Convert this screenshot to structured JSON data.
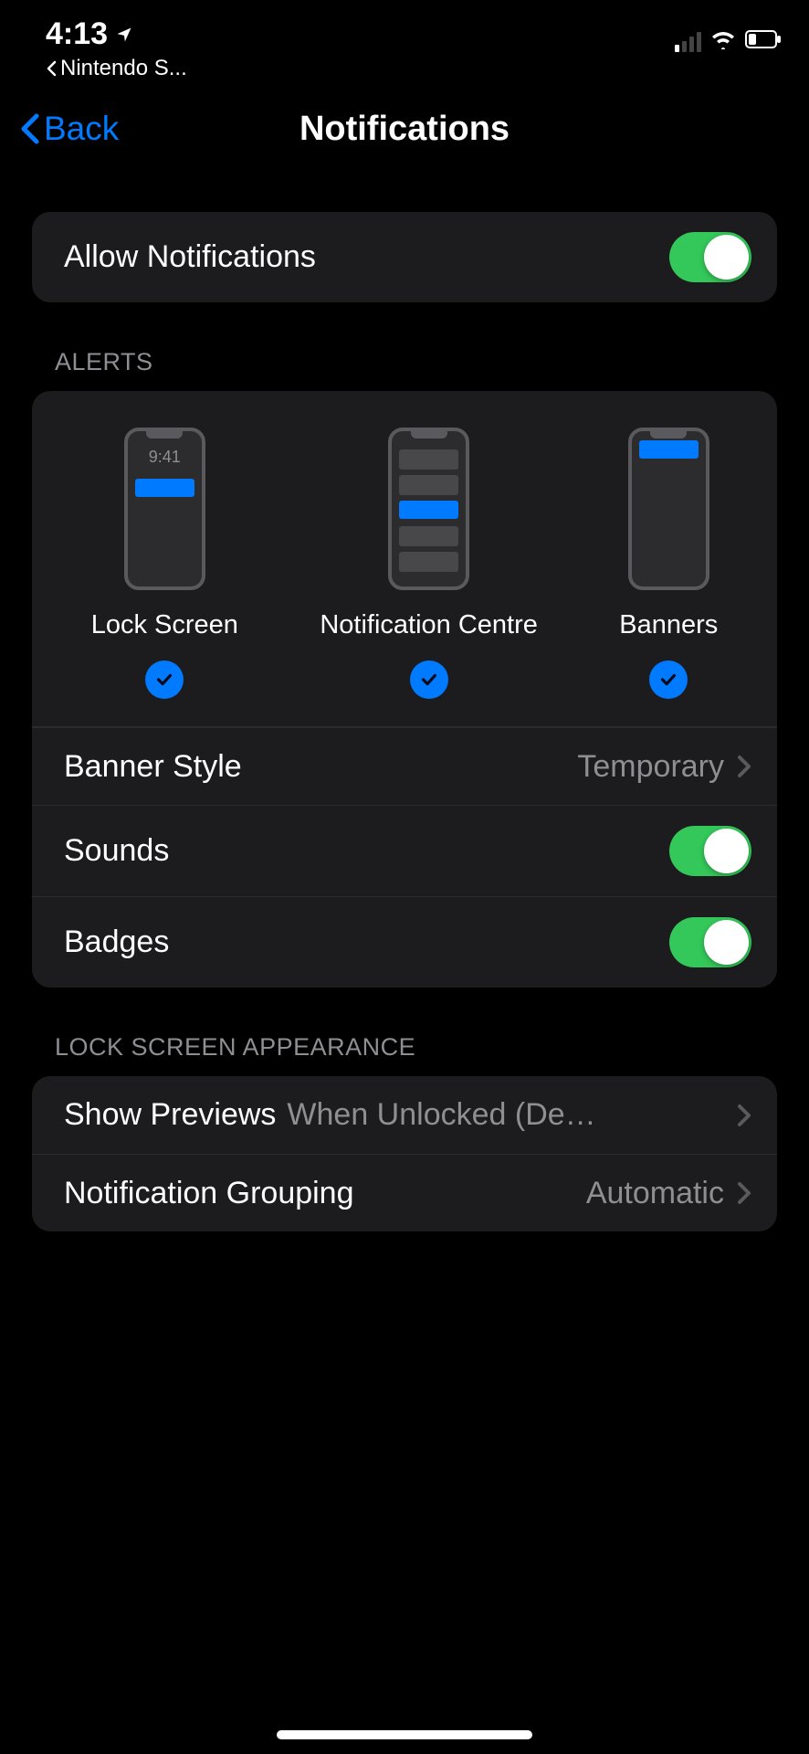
{
  "status": {
    "time": "4:13",
    "back_to_app": "Nintendo S..."
  },
  "nav": {
    "back_label": "Back",
    "title": "Notifications"
  },
  "allow_notifications": {
    "label": "Allow Notifications",
    "enabled": true
  },
  "alerts": {
    "header": "ALERTS",
    "phone_time": "9:41",
    "options": [
      {
        "label": "Lock Screen",
        "checked": true
      },
      {
        "label": "Notification Centre",
        "checked": true
      },
      {
        "label": "Banners",
        "checked": true
      }
    ],
    "banner_style": {
      "label": "Banner Style",
      "value": "Temporary"
    },
    "sounds": {
      "label": "Sounds",
      "enabled": true
    },
    "badges": {
      "label": "Badges",
      "enabled": true
    }
  },
  "lock_screen_appearance": {
    "header": "LOCK SCREEN APPEARANCE",
    "show_previews": {
      "label": "Show Previews",
      "value": "When Unlocked (Def..."
    },
    "notification_grouping": {
      "label": "Notification Grouping",
      "value": "Automatic"
    }
  }
}
